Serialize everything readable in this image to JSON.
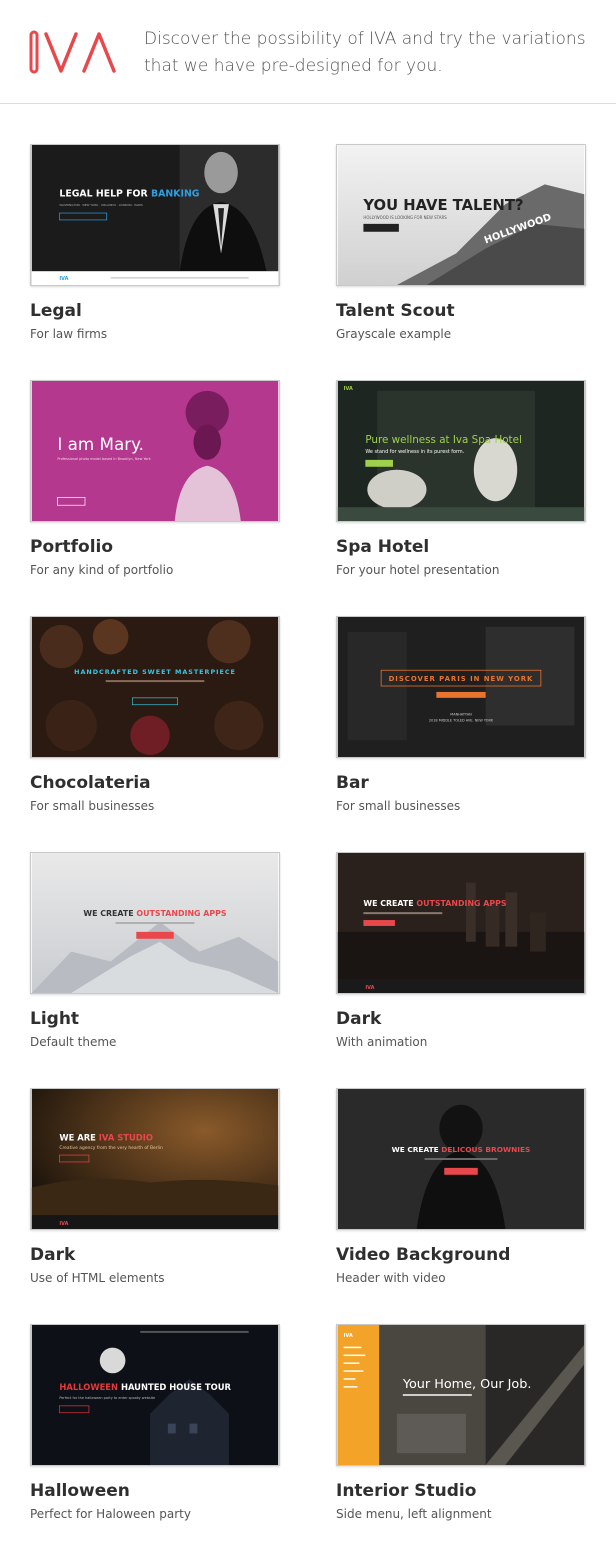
{
  "header": {
    "logo_text": "IVA",
    "logo_color": "#e8474c",
    "tagline": "Discover the possibility of IVA and try the variations that we have pre-designed for you."
  },
  "accent": "#e8474c",
  "cards": [
    {
      "title": "Legal",
      "subtitle": "For law firms",
      "thumb": {
        "headline_a": "LEGAL HELP FOR ",
        "headline_b": "BANKING",
        "sub": "WASHINGTON · NEW YORK · ORLANDO · LONDON · PARIS",
        "logo": "IVA"
      }
    },
    {
      "title": "Talent Scout",
      "subtitle": "Grayscale example",
      "thumb": {
        "headline": "YOU HAVE TALENT?",
        "sub": "HOLLYWOOD IS LOOKING FOR NEW STARS",
        "sign": "HOLLYWOOD"
      }
    },
    {
      "title": "Portfolio",
      "subtitle": "For any kind of portfolio",
      "thumb": {
        "headline": "I am Mary.",
        "sub": "Professional photo model based in Brooklyn, New York"
      }
    },
    {
      "title": "Spa Hotel",
      "subtitle": "For your hotel presentation",
      "thumb": {
        "headline": "Pure wellness at Iva Spa Hotel",
        "sub": "We stand for wellness in its purest form.",
        "logo": "IVA"
      }
    },
    {
      "title": "Chocolateria",
      "subtitle": "For small businesses",
      "thumb": {
        "headline": "HANDCRAFTED SWEET MASTERPIECE"
      }
    },
    {
      "title": "Bar",
      "subtitle": "For small businesses",
      "thumb": {
        "headline": "DISCOVER PARIS IN NEW YORK",
        "sub1": "MANHATTAN",
        "sub2": "2018 MIDDLE TOLED AVE. NEW YORK"
      }
    },
    {
      "title": "Light",
      "subtitle": "Default theme",
      "thumb": {
        "headline_a": "WE CREATE ",
        "headline_b": "OUTSTANDING APPS"
      }
    },
    {
      "title": "Dark",
      "subtitle": "With animation",
      "thumb": {
        "headline_a": "WE CREATE ",
        "headline_b": "OUTSTANDING APPS",
        "logo": "IVA"
      }
    },
    {
      "title": "Dark",
      "subtitle": "Use of HTML elements",
      "thumb": {
        "headline_a": "WE ARE ",
        "headline_b": "IVA STUDIO",
        "sub": "Creative agency from the very hearth of Berlin",
        "logo": "IVA"
      }
    },
    {
      "title": "Video Background",
      "subtitle": "Header with video",
      "thumb": {
        "headline_a": "WE CREATE ",
        "headline_b": "DELICOUS BROWNIES"
      }
    },
    {
      "title": "Halloween",
      "subtitle": "Perfect for Haloween party",
      "thumb": {
        "headline_a": "HALLOWEEN ",
        "headline_b": "HAUNTED HOUSE TOUR",
        "sub": "Perfect for the halloween party to enter spooky website"
      }
    },
    {
      "title": "Interior Studio",
      "subtitle": "Side menu, left alignment",
      "thumb": {
        "headline": "Your Home, Our Job.",
        "logo": "IVA"
      }
    }
  ]
}
